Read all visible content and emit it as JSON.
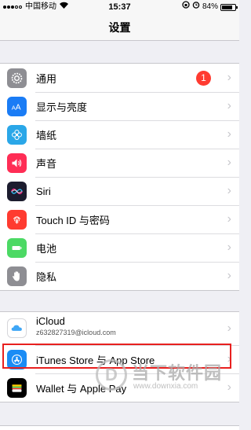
{
  "status_bar": {
    "carrier": "中国移动",
    "time": "15:37",
    "battery_percent": "84%",
    "battery_level": 0.84
  },
  "nav": {
    "title": "设置"
  },
  "group1": [
    {
      "label": "通用",
      "icon": "gear-icon",
      "color": "#8e8e93",
      "badge": "1"
    },
    {
      "label": "显示与亮度",
      "icon": "text-size-icon",
      "color": "#1a7cf5"
    },
    {
      "label": "墙纸",
      "icon": "flower-icon",
      "color": "#2aa7e8"
    },
    {
      "label": "声音",
      "icon": "speaker-icon",
      "color": "#ff2d55"
    },
    {
      "label": "Siri",
      "icon": "siri-icon",
      "color": "#1c1c2e"
    },
    {
      "label": "Touch ID 与密码",
      "icon": "fingerprint-icon",
      "color": "#ff3b30"
    },
    {
      "label": "电池",
      "icon": "battery-icon",
      "color": "#4cd964"
    },
    {
      "label": "隐私",
      "icon": "hand-icon",
      "color": "#8e8e93"
    }
  ],
  "group2": {
    "icloud": {
      "label": "iCloud",
      "sublabel": "z632827319@icloud.com",
      "icon": "cloud-icon"
    },
    "itunes": {
      "label": "iTunes Store 与 App Store",
      "icon": "app-store-icon",
      "color": "#1a8cf5"
    },
    "wallet": {
      "label": "Wallet 与 Apple Pay",
      "icon": "wallet-icon",
      "color": "#000000"
    }
  },
  "watermark": {
    "main": "当下软件园",
    "url": "www.downxia.com"
  },
  "colors": {
    "highlight": "#e8201f",
    "badge": "#ff3b30",
    "background": "#efeff4"
  }
}
